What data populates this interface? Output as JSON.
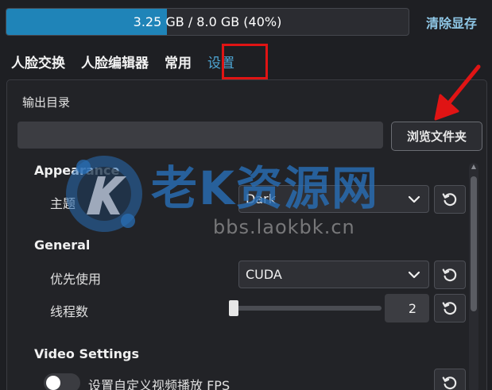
{
  "vram": {
    "text": "3.25 GB / 8.0 GB (40%)",
    "used_fraction": 0.4,
    "fill_color": "#1f84b8"
  },
  "clear_vram_label": "清除显存",
  "tabs": [
    {
      "label": "人脸交换"
    },
    {
      "label": "人脸编辑器"
    },
    {
      "label": "常用"
    },
    {
      "label": "设置",
      "active": true
    }
  ],
  "output": {
    "label": "输出目录",
    "value": "",
    "browse_label": "浏览文件夹"
  },
  "appearance": {
    "section": "Appearance",
    "theme_label": "主题",
    "theme_value": "Dark"
  },
  "general": {
    "section": "General",
    "priority_label": "优先使用",
    "priority_value": "CUDA",
    "threads_label": "线程数",
    "threads_value": "2",
    "threads_fraction": 0.0
  },
  "video": {
    "section": "Video Settings",
    "custom_fps_label": "设置自定义视频播放 FPS",
    "custom_fps_enabled": false
  },
  "watermark": {
    "text": "老K资源网",
    "url": "bbs.laokbk.cn"
  },
  "colors": {
    "accent": "#4ea6d4",
    "highlight_red": "#e01414"
  }
}
